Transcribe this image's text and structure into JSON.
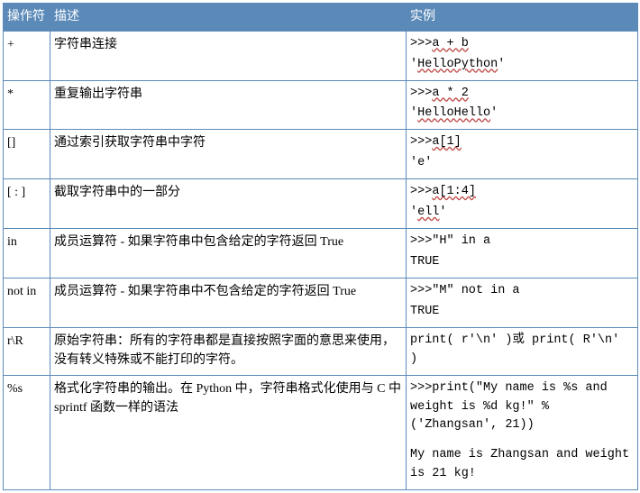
{
  "headers": {
    "op": "操作符",
    "desc": "描述",
    "ex": "实例"
  },
  "rows": [
    {
      "op": "+",
      "desc": "字符串连接",
      "ex_l1_pre": ">>>",
      "ex_l1_code": "a + b",
      "ex_l2_q1": "'",
      "ex_l2_code": "HelloPython",
      "ex_l2_q2": "'"
    },
    {
      "op": "*",
      "desc": "重复输出字符串",
      "ex_l1_pre": ">>>",
      "ex_l1_code": "a * 2",
      "ex_l2_q1": "'",
      "ex_l2_code": "HelloHello",
      "ex_l2_q2": "'"
    },
    {
      "op": "[]",
      "desc": "通过索引获取字符串中字符",
      "ex_l1_pre": ">>>",
      "ex_l1_code": "a[1]",
      "ex_l2": "'e'"
    },
    {
      "op": "[ : ]",
      "desc": "截取字符串中的一部分",
      "ex_l1_pre": ">>>",
      "ex_l1_code": "a[1:4]",
      "ex_l2_q1": "'",
      "ex_l2_code": "ell",
      "ex_l2_q2": "'"
    },
    {
      "op": "in",
      "desc": "成员运算符 - 如果字符串中包含给定的字符返回 True",
      "ex_l1": ">>>\"H\" in a",
      "ex_l2": "TRUE"
    },
    {
      "op": "not in",
      "desc": "成员运算符 - 如果字符串中不包含给定的字符返回 True",
      "ex_l1": ">>>\"M\" not in a",
      "ex_l2": "TRUE"
    },
    {
      "op": "r\\R",
      "desc": "原始字符串：所有的字符串都是直接按照字面的意思来使用，没有转义特殊或不能打印的字符。",
      "ex_l1": "print( r'\\n' )或 print( R'\\n' )"
    },
    {
      "op": "%s",
      "desc": "格式化字符串的输出。在 Python 中，字符串格式化使用与 C 中 sprintf 函数一样的语法",
      "ex_l1": ">>>print(\"My name is %s and weight is %d kg!\" % ('Zhangsan', 21))",
      "ex_l3": "My name is Zhangsan and weight is 21 kg!"
    }
  ]
}
